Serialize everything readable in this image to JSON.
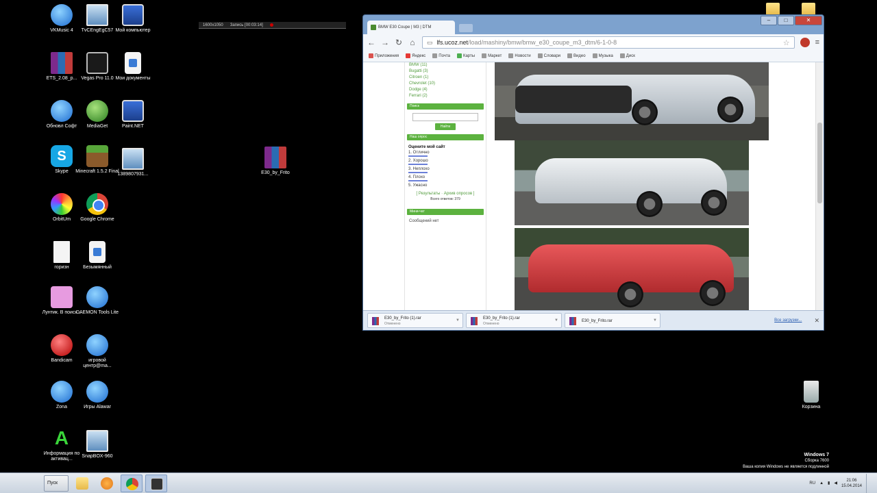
{
  "desktop": {
    "icons": [
      {
        "label": "VKMusic 4"
      },
      {
        "label": "TvCEngEgC57"
      },
      {
        "label": "Мой компьютер"
      },
      {
        "label": "ETS_2.08_p..."
      },
      {
        "label": "Vegas Pro 11.0"
      },
      {
        "label": "Мои документы"
      },
      {
        "label": "Обновл Софт"
      },
      {
        "label": "MediaGet"
      },
      {
        "label": "Paint.NET"
      },
      {
        "label": "Skype"
      },
      {
        "label": "Minecraft 1.5.2 Final"
      },
      {
        "label": "1389807931..."
      },
      {
        "label": "E30_by_Frito"
      },
      {
        "label": "OrbitUm"
      },
      {
        "label": "Google Chrome"
      },
      {
        "label": "горизн"
      },
      {
        "label": "Безымянный"
      },
      {
        "label": "Лунтик. В поиск..."
      },
      {
        "label": "DAEMON Tools Lite"
      },
      {
        "label": "Bandicam"
      },
      {
        "label": "игровой центр@ma..."
      },
      {
        "label": "Zona"
      },
      {
        "label": "Игры Alawar"
      },
      {
        "label": "Информация по активац..."
      },
      {
        "label": "SnapBOX-960"
      },
      {
        "label": "Корзина"
      }
    ]
  },
  "recorder": {
    "resolution": "1600x1050",
    "timer": "Запись [00:03:14]"
  },
  "browser": {
    "tab_title": "BMW E30 Coupe | M3 | DTM",
    "url_main": "lfs.ucoz.net",
    "url_rest": "/load/mashiny/bmw/bmw_e30_coupe_m3_dtm/6-1-0-8",
    "bookmarks": [
      "Приложения",
      "Яндекс",
      "Почта",
      "Карты",
      "Маркет",
      "Новости",
      "Словари",
      "Видео",
      "Музыка",
      "Диск"
    ],
    "sidebar": {
      "categories": [
        "BMW (11)",
        "Bugatti (3)",
        "Citroen (1)",
        "Chevrolet (10)",
        "Dodge (4)",
        "Ferrari (2)"
      ],
      "search_head": "Поиск",
      "search_button": "Найти",
      "poll_head": "Наш опрос",
      "poll_question": "Оцените мой сайт",
      "poll_options": [
        "1. Отлично",
        "2. Хорошо",
        "3. Неплохо",
        "4. Плохо",
        "5. Ужасно"
      ],
      "poll_results_label": "[ Результаты · Архив опросов ]",
      "poll_total": "Всего ответов: 379",
      "chat_head": "Мини-чат",
      "chat_text": "Сообщений нет"
    },
    "downloads": [
      {
        "name": "E30_by_Frito (1).rar",
        "status": "Отменено"
      },
      {
        "name": "E30_by_Frito (1).rar",
        "status": "Отменено"
      },
      {
        "name": "E30_by_Frito.rar",
        "status": ""
      }
    ],
    "downloads_all": "Все загрузки..."
  },
  "watermark": {
    "title": "Windows 7",
    "build": "Сборка 7600",
    "notice": "Ваша копия Windows не является подлинной"
  },
  "taskbar": {
    "start_label": "Пуск",
    "lang": "RU",
    "time": "21:06",
    "date": "15.04.2014"
  },
  "colors": {
    "desktop": "#000000",
    "site_green": "#5cb23f",
    "chrome_frame": "#7da2ce"
  }
}
